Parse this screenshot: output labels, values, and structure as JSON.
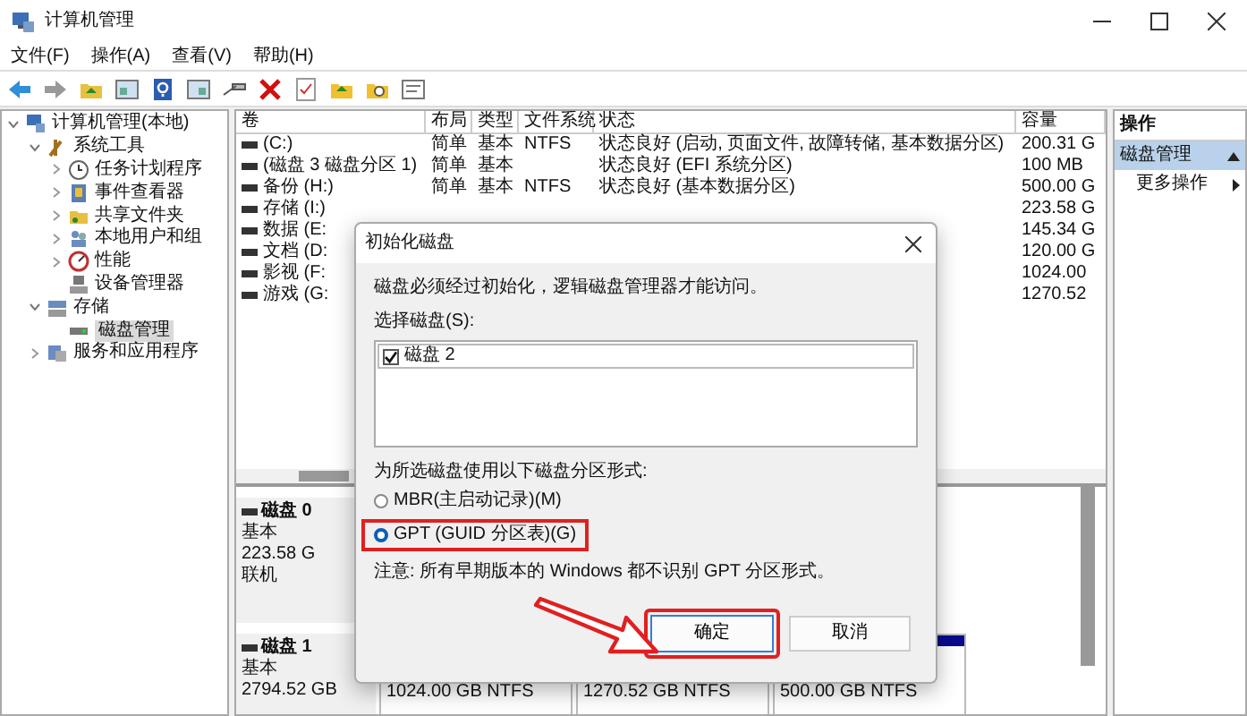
{
  "window": {
    "title": "计算机管理"
  },
  "menu": [
    "文件(F)",
    "操作(A)",
    "查看(V)",
    "帮助(H)"
  ],
  "tree": [
    {
      "label": "计算机管理(本地)",
      "selected": false,
      "expanded": true,
      "children": [
        {
          "label": "系统工具",
          "selected": false,
          "expanded": true,
          "children": [
            {
              "label": "任务计划程序",
              "selected": false,
              "expanded": false
            },
            {
              "label": "事件查看器",
              "selected": false,
              "expanded": false
            },
            {
              "label": "共享文件夹",
              "selected": false,
              "expanded": false
            },
            {
              "label": "本地用户和组",
              "selected": false,
              "expanded": false
            },
            {
              "label": "性能",
              "selected": false,
              "expanded": false
            },
            {
              "label": "设备管理器",
              "selected": false
            }
          ]
        },
        {
          "label": "存储",
          "selected": false,
          "expanded": true,
          "children": [
            {
              "label": "磁盘管理",
              "selected": true
            }
          ]
        },
        {
          "label": "服务和应用程序",
          "selected": false,
          "expanded": false
        }
      ]
    }
  ],
  "volumes": {
    "columns": [
      "卷",
      "布局",
      "类型",
      "文件系统",
      "状态",
      "容量"
    ],
    "rows": [
      {
        "volume": "(C:)",
        "layout": "简单",
        "type": "基本",
        "fs": "NTFS",
        "status": "状态良好 (启动, 页面文件, 故障转储, 基本数据分区)",
        "capacity": "200.31 G"
      },
      {
        "volume": "(磁盘 3 磁盘分区 1)",
        "layout": "简单",
        "type": "基本",
        "status": "状态良好 (EFI 系统分区)",
        "capacity": "100 MB"
      },
      {
        "volume": "备份 (H:)",
        "layout": "简单",
        "type": "基本",
        "fs": "NTFS",
        "status": "状态良好 (基本数据分区)",
        "capacity": "500.00 G"
      },
      {
        "volume": "存储 (I:)",
        "capacity": "223.58 G"
      },
      {
        "volume": "数据 (E:",
        "capacity": "145.34 G"
      },
      {
        "volume": "文档 (D:",
        "capacity": "120.00 G"
      },
      {
        "volume": "影视 (F:",
        "capacity": "1024.00"
      },
      {
        "volume": "游戏 (G:",
        "capacity": "1270.52"
      }
    ]
  },
  "disks": [
    {
      "name": "磁盘 0",
      "type": "基本",
      "size": "223.58 G",
      "state": "联机"
    },
    {
      "name": "磁盘 1",
      "type": "基本",
      "size": "2794.52 GB",
      "partitions": [
        {
          "size": "1024.00 GB NTFS"
        },
        {
          "size": "1270.52 GB NTFS"
        },
        {
          "size": "500.00 GB NTFS"
        }
      ]
    }
  ],
  "actions": {
    "title": "操作",
    "sections": [
      {
        "label": "磁盘管理",
        "expanded": true,
        "items": [
          "更多操作"
        ]
      }
    ]
  },
  "dialog": {
    "title": "初始化磁盘",
    "message": "磁盘必须经过初始化，逻辑磁盘管理器才能访问。",
    "select_label": "选择磁盘(S):",
    "disks": [
      {
        "label": "磁盘 2",
        "checked": true
      }
    ],
    "style_label": "为所选磁盘使用以下磁盘分区形式:",
    "options": [
      {
        "label": "MBR(主启动记录)(M)",
        "selected": false,
        "highlighted": false
      },
      {
        "label": "GPT (GUID 分区表)(G)",
        "selected": true,
        "highlighted": true
      }
    ],
    "note": "注意: 所有早期版本的 Windows 都不识别 GPT 分区形式。",
    "buttons": [
      {
        "label": "确定",
        "default": true,
        "highlighted": true
      },
      {
        "label": "取消",
        "default": false,
        "highlighted": false
      }
    ],
    "arrow": true
  }
}
